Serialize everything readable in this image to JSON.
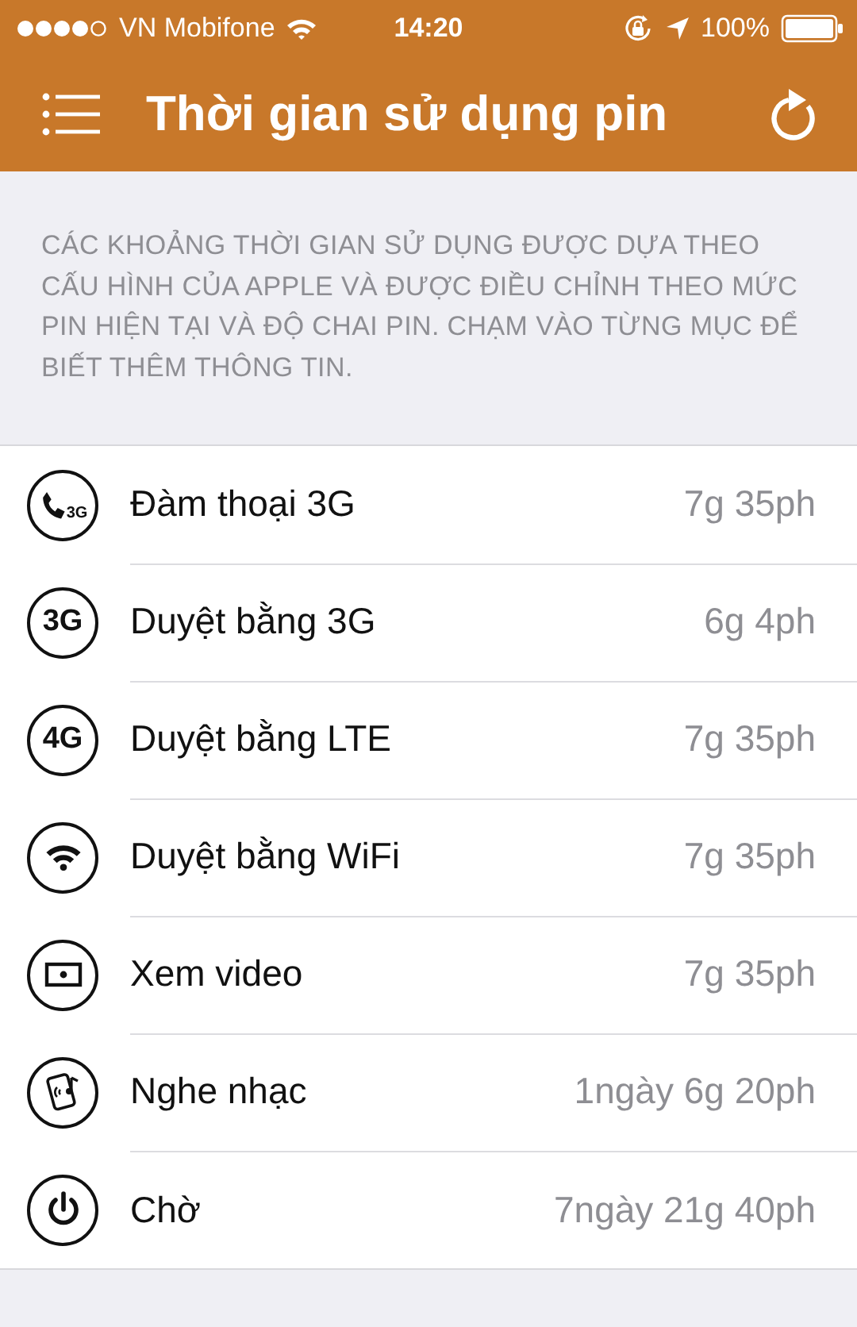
{
  "status_bar": {
    "carrier": "VN Mobifone",
    "time": "14:20",
    "battery": "100%"
  },
  "nav_bar": {
    "title": "Thời gian sử dụng pin"
  },
  "description": "CÁC KHOẢNG THỜI GIAN SỬ DỤNG ĐƯỢC DỰA THEO CẤU HÌNH CỦA APPLE VÀ ĐƯỢC ĐIỀU CHỈNH THEO MỨC PIN HIỆN TẠI VÀ ĐỘ CHAI PIN. CHẠM VÀO TỪNG MỤC ĐỂ BIẾT THÊM THÔNG TIN.",
  "rows": [
    {
      "kind": "call",
      "badge": "3G",
      "label": "Đàm thoại 3G",
      "value": "7g 35ph"
    },
    {
      "kind": "network",
      "badge": "3G",
      "label": "Duyệt bằng 3G",
      "value": "6g 4ph"
    },
    {
      "kind": "network",
      "badge": "4G",
      "label": "Duyệt bằng LTE",
      "value": "7g 35ph"
    },
    {
      "kind": "wifi",
      "label": "Duyệt bằng WiFi",
      "value": "7g 35ph"
    },
    {
      "kind": "video",
      "label": "Xem video",
      "value": "7g 35ph"
    },
    {
      "kind": "music",
      "label": "Nghe nhạc",
      "value": "1ngày 6g 20ph"
    },
    {
      "kind": "standby",
      "label": "Chờ",
      "value": "7ngày 21g 40ph"
    }
  ]
}
